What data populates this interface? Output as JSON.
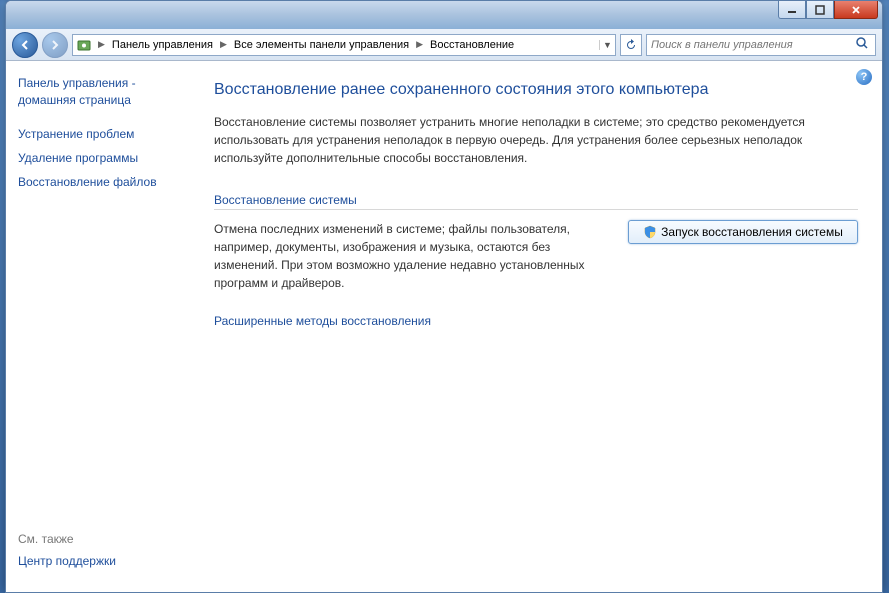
{
  "breadcrumb": {
    "seg1": "Панель управления",
    "seg2": "Все элементы панели управления",
    "seg3": "Восстановление"
  },
  "search": {
    "placeholder": "Поиск в панели управления"
  },
  "sidebar": {
    "home": "Панель управления - домашняя страница",
    "link1": "Устранение проблем",
    "link2": "Удаление программы",
    "link3": "Восстановление файлов",
    "footer_header": "См. также",
    "footer_link": "Центр поддержки"
  },
  "main": {
    "title": "Восстановление ранее сохраненного состояния этого компьютера",
    "description": "Восстановление системы позволяет устранить многие неполадки в системе; это средство рекомендуется использовать для устранения неполадок в первую очередь. Для устранения более серьезных неполадок используйте дополнительные способы восстановления.",
    "section_header": "Восстановление системы",
    "restore_desc": "Отмена последних изменений в системе; файлы пользователя, например, документы, изображения и музыка, остаются без изменений. При этом возможно удаление недавно установленных программ и драйверов.",
    "restore_button": "Запуск восстановления системы",
    "advanced_link": "Расширенные методы восстановления"
  }
}
